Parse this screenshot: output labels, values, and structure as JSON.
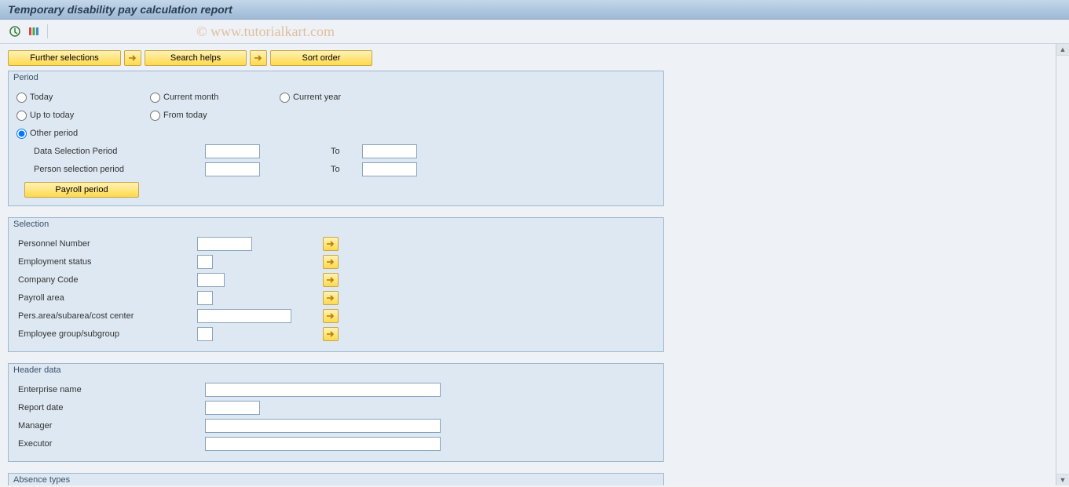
{
  "title": "Temporary disability pay calculation report",
  "watermark": "© www.tutorialkart.com",
  "ribbon": {
    "further_selections": "Further selections",
    "search_helps": "Search helps",
    "sort_order": "Sort order"
  },
  "period": {
    "group_title": "Period",
    "today": "Today",
    "current_month": "Current month",
    "current_year": "Current year",
    "up_to_today": "Up to today",
    "from_today": "From today",
    "other_period": "Other period",
    "data_selection_period": "Data Selection Period",
    "person_selection_period": "Person selection period",
    "to": "To",
    "payroll_period": "Payroll period"
  },
  "selection": {
    "group_title": "Selection",
    "personnel_number": "Personnel Number",
    "employment_status": "Employment status",
    "company_code": "Company Code",
    "payroll_area": "Payroll area",
    "pers_area": "Pers.area/subarea/cost center",
    "employee_group": "Employee group/subgroup"
  },
  "header_data": {
    "group_title": "Header data",
    "enterprise_name": "Enterprise name",
    "report_date": "Report date",
    "manager": "Manager",
    "executor": "Executor"
  },
  "absence": {
    "group_title": "Absence types"
  }
}
